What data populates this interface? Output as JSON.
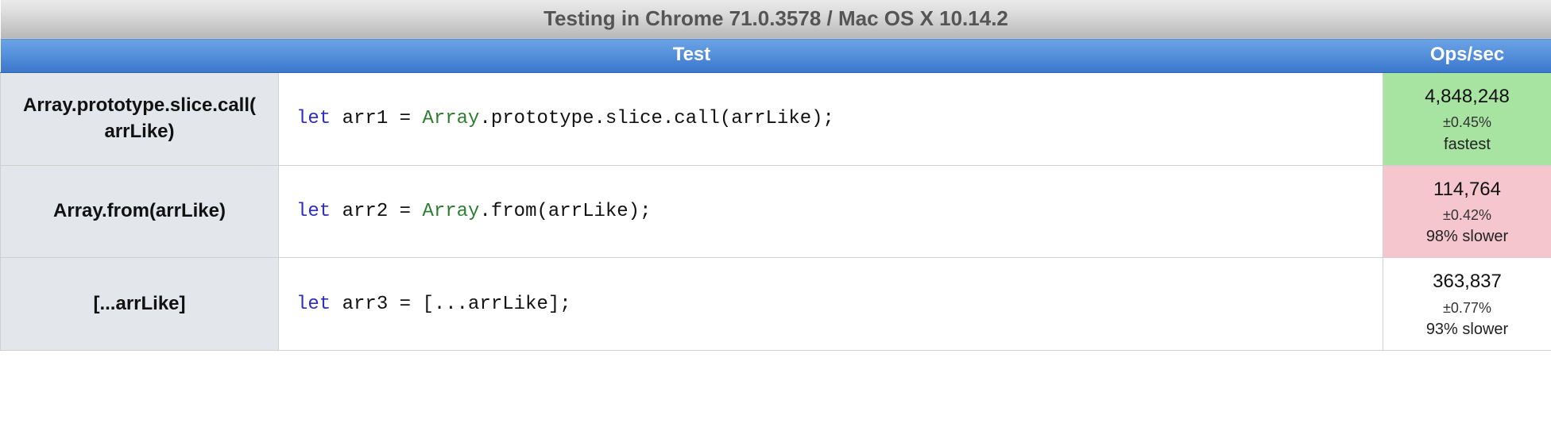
{
  "title": "Testing in Chrome 71.0.3578 / Mac OS X 10.14.2",
  "headers": {
    "test": "Test",
    "ops": "Ops/sec"
  },
  "rows": [
    {
      "label_l1": "Array.prototype.slice.call(",
      "label_l2": "arrLike)",
      "code_pre": "let",
      "code_var": " arr1 = ",
      "code_glob": "Array",
      "code_rest": ".prototype.slice.call(arrLike);",
      "ops": "4,848,248",
      "err": "±0.45%",
      "note": "fastest",
      "tone": "green"
    },
    {
      "label_l1": "Array.from(arrLike)",
      "label_l2": "",
      "code_pre": "let",
      "code_var": " arr2 = ",
      "code_glob": "Array",
      "code_rest": ".from(arrLike);",
      "ops": "114,764",
      "err": "±0.42%",
      "note": "98% slower",
      "tone": "red"
    },
    {
      "label_l1": "[...arrLike]",
      "label_l2": "",
      "code_pre": "let",
      "code_var": " arr3 = [...arrLike];",
      "code_glob": "",
      "code_rest": "",
      "ops": "363,837",
      "err": "±0.77%",
      "note": "93% slower",
      "tone": "plain"
    }
  ]
}
